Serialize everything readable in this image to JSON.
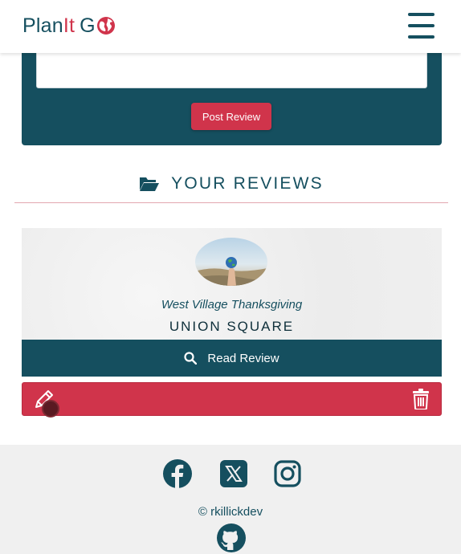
{
  "brand": {
    "part1": "Plan",
    "part2": "It",
    "part3": "G"
  },
  "form": {
    "post_label": "Post Review"
  },
  "section": {
    "title": "YOUR REVIEWS"
  },
  "review": {
    "title": "West Village Thanksgiving",
    "location": "UNION SQUARE",
    "read_label": "Read Review"
  },
  "footer": {
    "copyright": "© rkillickdev"
  },
  "icons": {
    "logo_globe": "globe-icon",
    "menu": "hamburger-menu-icon",
    "section": "folder-open-icon",
    "read": "search-icon",
    "edit": "pencil-icon",
    "delete": "trash-icon",
    "social": [
      "facebook-icon",
      "x-icon",
      "instagram-icon",
      "github-icon"
    ]
  },
  "colors": {
    "primary": "#154f5f",
    "accent": "#d0344b",
    "card_bg": "#efefef",
    "footer_bg": "#f0f0f0"
  }
}
